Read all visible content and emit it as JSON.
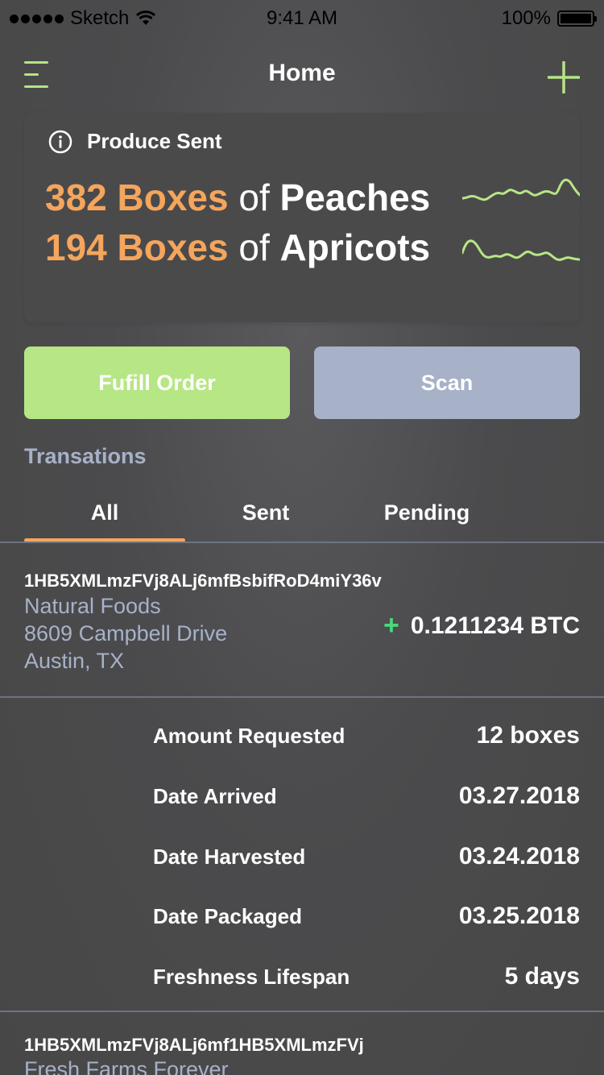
{
  "status_bar": {
    "carrier": "Sketch",
    "time": "9:41 AM",
    "battery": "100%"
  },
  "nav": {
    "title": "Home",
    "menu_icon": "hamburger-menu-icon",
    "add_icon": "plus-icon"
  },
  "summary_card": {
    "heading": "Produce Sent",
    "icon": "info-icon",
    "items": [
      {
        "count": "382 Boxes",
        "of": "of",
        "name": "Peaches"
      },
      {
        "count": "194 Boxes",
        "of": "of",
        "name": "Apricots"
      }
    ]
  },
  "buttons": {
    "fulfill": "Fufill Order",
    "scan": "Scan"
  },
  "transactions": {
    "section_title": "Transations",
    "tabs": [
      "All",
      "Sent",
      "Pending"
    ],
    "active_tab": "All",
    "items": [
      {
        "id": "1HB5XMLmzFVj8ALj6mfBsbifRoD4miY36v",
        "name": "Natural Foods",
        "street": "8609 Campbell Drive",
        "city": "Austin, TX",
        "sign": "+",
        "amount": "0.1211234 BTC"
      },
      {
        "id": "1HB5XMLmzFVj8ALj6mf1HB5XMLmzFVj",
        "name": "Fresh Farms Forever"
      }
    ],
    "details": [
      {
        "label": "Amount Requested",
        "value": "12 boxes"
      },
      {
        "label": "Date Arrived",
        "value": "03.27.2018"
      },
      {
        "label": "Date Harvested",
        "value": "03.24.2018"
      },
      {
        "label": "Date Packaged",
        "value": "03.25.2018"
      },
      {
        "label": "Freshness Lifespan",
        "value": "5 days"
      }
    ]
  },
  "colors": {
    "accent_orange": "#f5a55c",
    "accent_green": "#b7e685",
    "muted_blue": "#a7b1c8",
    "positive_green": "#4bd67c"
  }
}
